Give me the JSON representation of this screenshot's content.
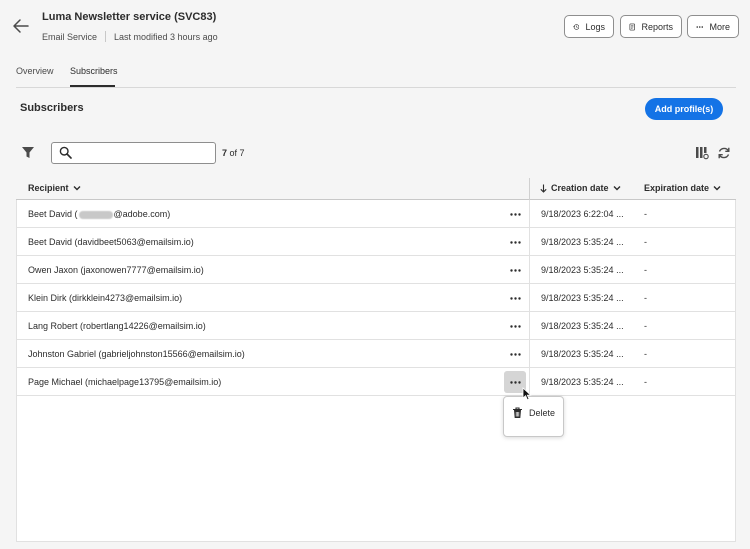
{
  "header": {
    "title": "Luma Newsletter service (SVC83)",
    "service_type": "Email Service",
    "last_modified": "Last modified 3 hours ago",
    "buttons": {
      "logs": "Logs",
      "reports": "Reports",
      "more": "More"
    }
  },
  "tabs": [
    {
      "label": "Overview",
      "active": false
    },
    {
      "label": "Subscribers",
      "active": true
    }
  ],
  "section": {
    "title": "Subscribers",
    "add_button": "Add profile(s)"
  },
  "search": {
    "value": "",
    "placeholder": ""
  },
  "count": {
    "shown": "7",
    "of_text": "of 7"
  },
  "table": {
    "columns": {
      "recipient": "Recipient",
      "creation": "Creation date",
      "expiration": "Expiration date"
    },
    "rows": [
      {
        "recipient_prefix": "Beet David (",
        "recipient_suffix": "@adobe.com)",
        "creation": "9/18/2023 6:22:04 ...",
        "expiration": "-"
      },
      {
        "recipient": "Beet David (davidbeet5063@emailsim.io)",
        "creation": "9/18/2023 5:35:24 ...",
        "expiration": "-"
      },
      {
        "recipient": "Owen Jaxon (jaxonowen7777@emailsim.io)",
        "creation": "9/18/2023 5:35:24 ...",
        "expiration": "-"
      },
      {
        "recipient": "Klein Dirk (dirkklein4273@emailsim.io)",
        "creation": "9/18/2023 5:35:24 ...",
        "expiration": "-"
      },
      {
        "recipient": "Lang Robert (robertlang14226@emailsim.io)",
        "creation": "9/18/2023 5:35:24 ...",
        "expiration": "-"
      },
      {
        "recipient": "Johnston Gabriel (gabrieljohnston15566@emailsim.io)",
        "creation": "9/18/2023 5:35:24 ...",
        "expiration": "-"
      },
      {
        "recipient": "Page Michael (michaelpage13795@emailsim.io)",
        "creation": "9/18/2023 5:35:24 ...",
        "expiration": "-"
      }
    ]
  },
  "context_menu": {
    "delete_label": "Delete"
  },
  "colors": {
    "accent": "#1473e6",
    "hover": "#d5d5d5"
  }
}
